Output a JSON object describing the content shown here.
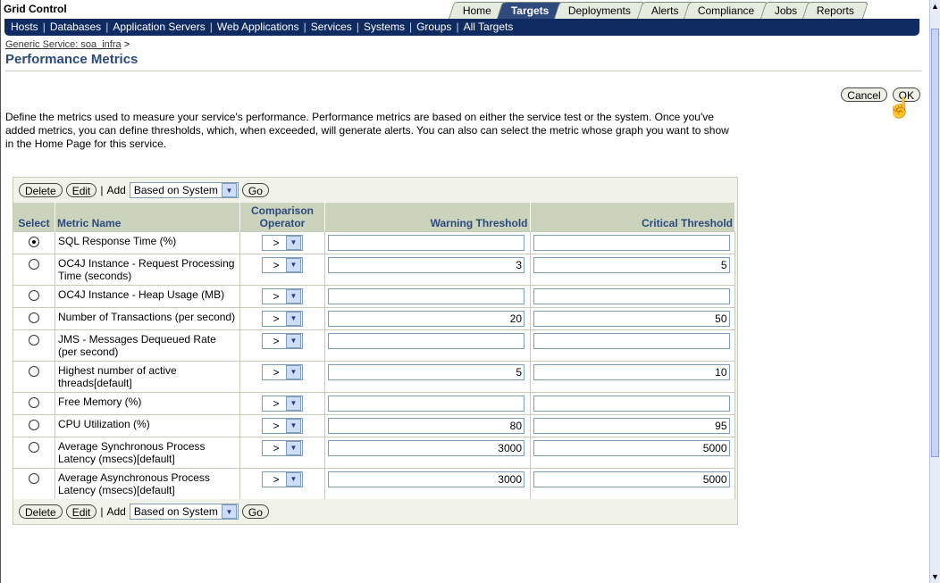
{
  "header": {
    "app_title": "Grid Control",
    "tabs": [
      {
        "label": "Home",
        "active": false
      },
      {
        "label": "Targets",
        "active": true
      },
      {
        "label": "Deployments",
        "active": false
      },
      {
        "label": "Alerts",
        "active": false
      },
      {
        "label": "Compliance",
        "active": false
      },
      {
        "label": "Jobs",
        "active": false
      },
      {
        "label": "Reports",
        "active": false
      }
    ]
  },
  "subnav": [
    "Hosts",
    "Databases",
    "Application Servers",
    "Web Applications",
    "Services",
    "Systems",
    "Groups",
    "All Targets"
  ],
  "breadcrumb": {
    "link": "Generic Service: soa_infra",
    "sep": ">"
  },
  "page": {
    "title": "Performance Metrics",
    "cancel_label": "Cancel",
    "ok_label": "OK",
    "description": "Define the metrics used to measure your service's performance. Performance metrics are based on either the service test or the system. Once you've added metrics, you can define thresholds, which, when exceeded, will generate alerts. You can also can select the metric whose graph you want to show in the Home Page for this service."
  },
  "toolbar": {
    "delete_label": "Delete",
    "edit_label": "Edit",
    "sep": "|",
    "add_label": "Add",
    "source_selected": "Based on System",
    "go_label": "Go"
  },
  "table": {
    "headers": {
      "select": "Select",
      "metric": "Metric Name",
      "comparison": "Comparison Operator",
      "warning": "Warning Threshold",
      "critical": "Critical Threshold"
    },
    "rows": [
      {
        "selected": true,
        "name": "SQL Response Time (%)",
        "op": ">",
        "warning": "",
        "critical": ""
      },
      {
        "selected": false,
        "name": "OC4J Instance - Request Processing Time (seconds)",
        "op": ">",
        "warning": "3",
        "critical": "5"
      },
      {
        "selected": false,
        "name": "OC4J Instance - Heap Usage (MB)",
        "op": ">",
        "warning": "",
        "critical": ""
      },
      {
        "selected": false,
        "name": "Number of Transactions (per second)",
        "op": ">",
        "warning": "20",
        "critical": "50"
      },
      {
        "selected": false,
        "name": "JMS - Messages Dequeued Rate (per second)",
        "op": ">",
        "warning": "",
        "critical": ""
      },
      {
        "selected": false,
        "name": "Highest number of active threads[default]",
        "op": ">",
        "warning": "5",
        "critical": "10"
      },
      {
        "selected": false,
        "name": "Free Memory (%)",
        "op": ">",
        "warning": "",
        "critical": ""
      },
      {
        "selected": false,
        "name": "CPU Utilization (%)",
        "op": ">",
        "warning": "80",
        "critical": "95"
      },
      {
        "selected": false,
        "name": "Average Synchronous Process Latency (msecs)[default]",
        "op": ">",
        "warning": "3000",
        "critical": "5000"
      },
      {
        "selected": false,
        "name": "Average Asynchronous Process Latency (msecs)[default]",
        "op": ">",
        "warning": "3000",
        "critical": "5000"
      }
    ]
  }
}
